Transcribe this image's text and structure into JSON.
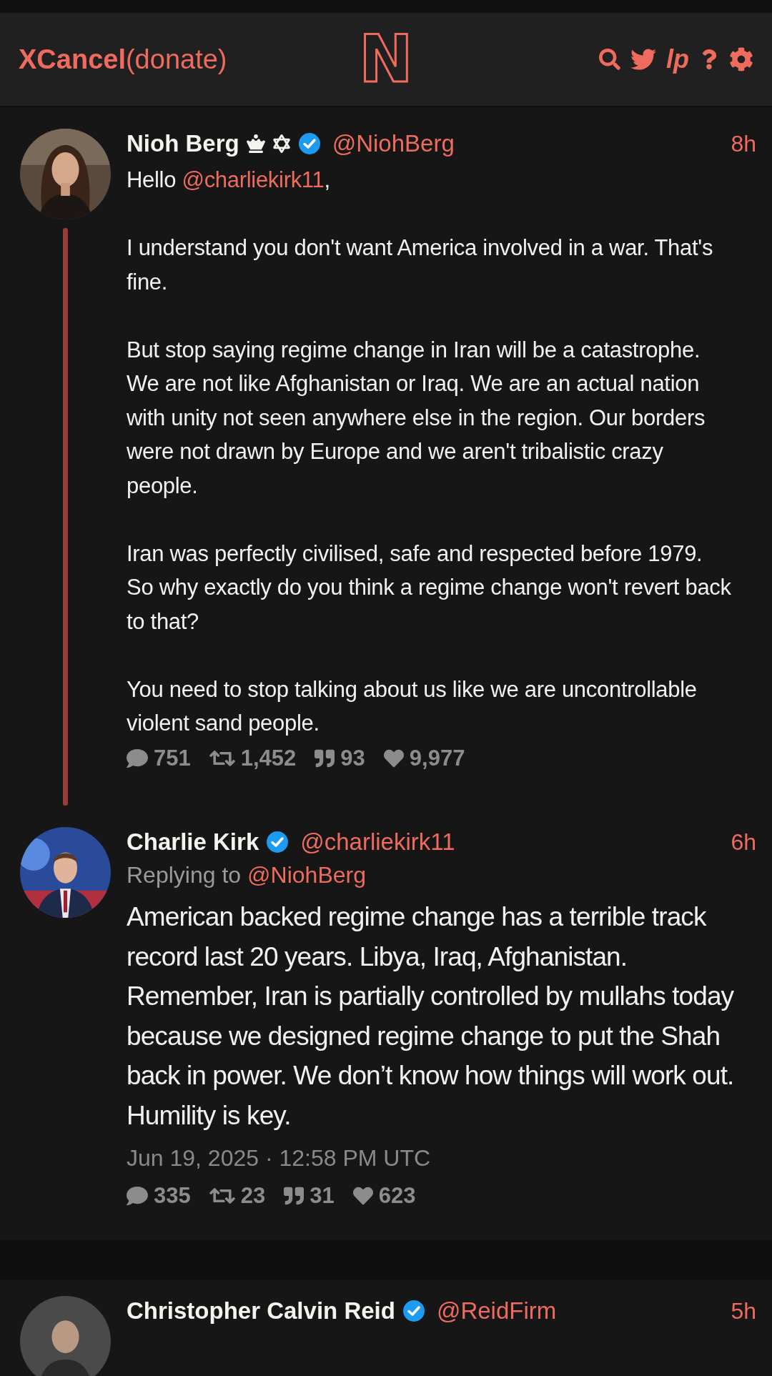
{
  "header": {
    "brand": "XCancel",
    "donate": "(donate)",
    "logo": "N",
    "nav_text": "lp"
  },
  "tweets": [
    {
      "name": "Nioh Berg",
      "crown": true,
      "star_badge": true,
      "verified": true,
      "handle": "@NiohBerg",
      "time": "8h",
      "thread_line": true,
      "large": false,
      "paragraphs": [
        [
          {
            "kind": "text",
            "text": "Hello "
          },
          {
            "kind": "mention",
            "text": "@charliekirk11"
          },
          {
            "kind": "text",
            "text": ","
          }
        ],
        [
          {
            "kind": "text",
            "text": "I understand you don't want America involved in a war. That's fine."
          }
        ],
        [
          {
            "kind": "text",
            "text": "But stop saying regime change in Iran will be a catastrophe. We are not like Afghanistan or Iraq. We are an actual nation with unity not seen anywhere else in the region. Our borders were not drawn by Europe and we aren't tribalistic crazy people."
          }
        ],
        [
          {
            "kind": "text",
            "text": "Iran was perfectly civilised, safe and respected before 1979. So why exactly do you think a regime change won't revert back to that?"
          }
        ],
        [
          {
            "kind": "text",
            "text": "You need to stop talking about us like we are uncontrollable violent sand people."
          }
        ]
      ],
      "stats": {
        "replies": "751",
        "retweets": "1,452",
        "quotes": "93",
        "likes": "9,977"
      }
    },
    {
      "name": "Charlie Kirk",
      "verified": true,
      "handle": "@charliekirk11",
      "time": "6h",
      "thread_line": false,
      "large": true,
      "replying_to": {
        "label": "Replying to",
        "handle": "@NiohBerg"
      },
      "paragraphs": [
        [
          {
            "kind": "text",
            "text": "American backed regime change has a terrible track record last 20 years. Libya, Iraq, Afghanistan. Remember, Iran is partially controlled by mullahs today because we designed regime change to put the Shah back in power. We don’t know how things will work out. Humility is key."
          }
        ]
      ],
      "date": "Jun 19, 2025 · 12:58 PM UTC",
      "stats": {
        "replies": "335",
        "retweets": "23",
        "quotes": "31",
        "likes": "623"
      }
    }
  ],
  "next_tweet": {
    "name": "Christopher Calvin Reid",
    "verified": true,
    "handle": "@ReidFirm",
    "time": "5h"
  }
}
